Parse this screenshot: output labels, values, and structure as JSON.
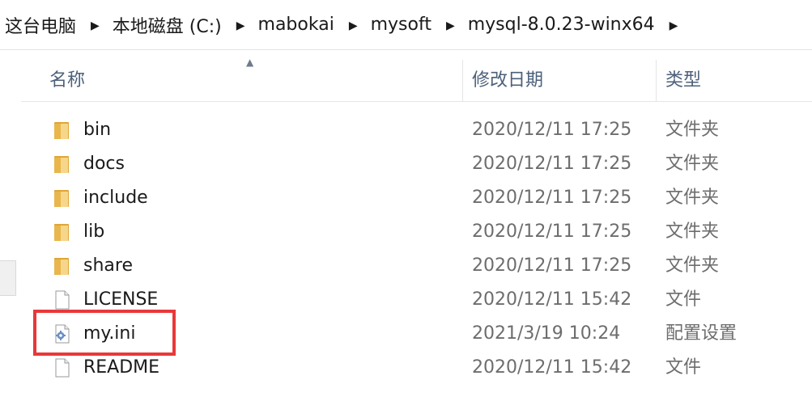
{
  "breadcrumbs": [
    "这台电脑",
    "本地磁盘 (C:)",
    "mabokai",
    "mysoft",
    "mysql-8.0.23-winx64"
  ],
  "columns": {
    "name": "名称",
    "date": "修改日期",
    "type": "类型"
  },
  "files": [
    {
      "name": "bin",
      "date": "2020/12/11 17:25",
      "type": "文件夹",
      "icon": "folder-icon"
    },
    {
      "name": "docs",
      "date": "2020/12/11 17:25",
      "type": "文件夹",
      "icon": "folder-icon"
    },
    {
      "name": "include",
      "date": "2020/12/11 17:25",
      "type": "文件夹",
      "icon": "folder-icon"
    },
    {
      "name": "lib",
      "date": "2020/12/11 17:25",
      "type": "文件夹",
      "icon": "folder-icon"
    },
    {
      "name": "share",
      "date": "2020/12/11 17:25",
      "type": "文件夹",
      "icon": "folder-icon"
    },
    {
      "name": "LICENSE",
      "date": "2020/12/11 15:42",
      "type": "文件",
      "icon": "file-icon"
    },
    {
      "name": "my.ini",
      "date": "2021/3/19 10:24",
      "type": "配置设置",
      "icon": "config-file-icon"
    },
    {
      "name": "README",
      "date": "2020/12/11 15:42",
      "type": "文件",
      "icon": "file-icon"
    }
  ],
  "colors": {
    "highlight": "#e8383a",
    "folder": "#e8b64c",
    "header_text": "#4c607a"
  }
}
